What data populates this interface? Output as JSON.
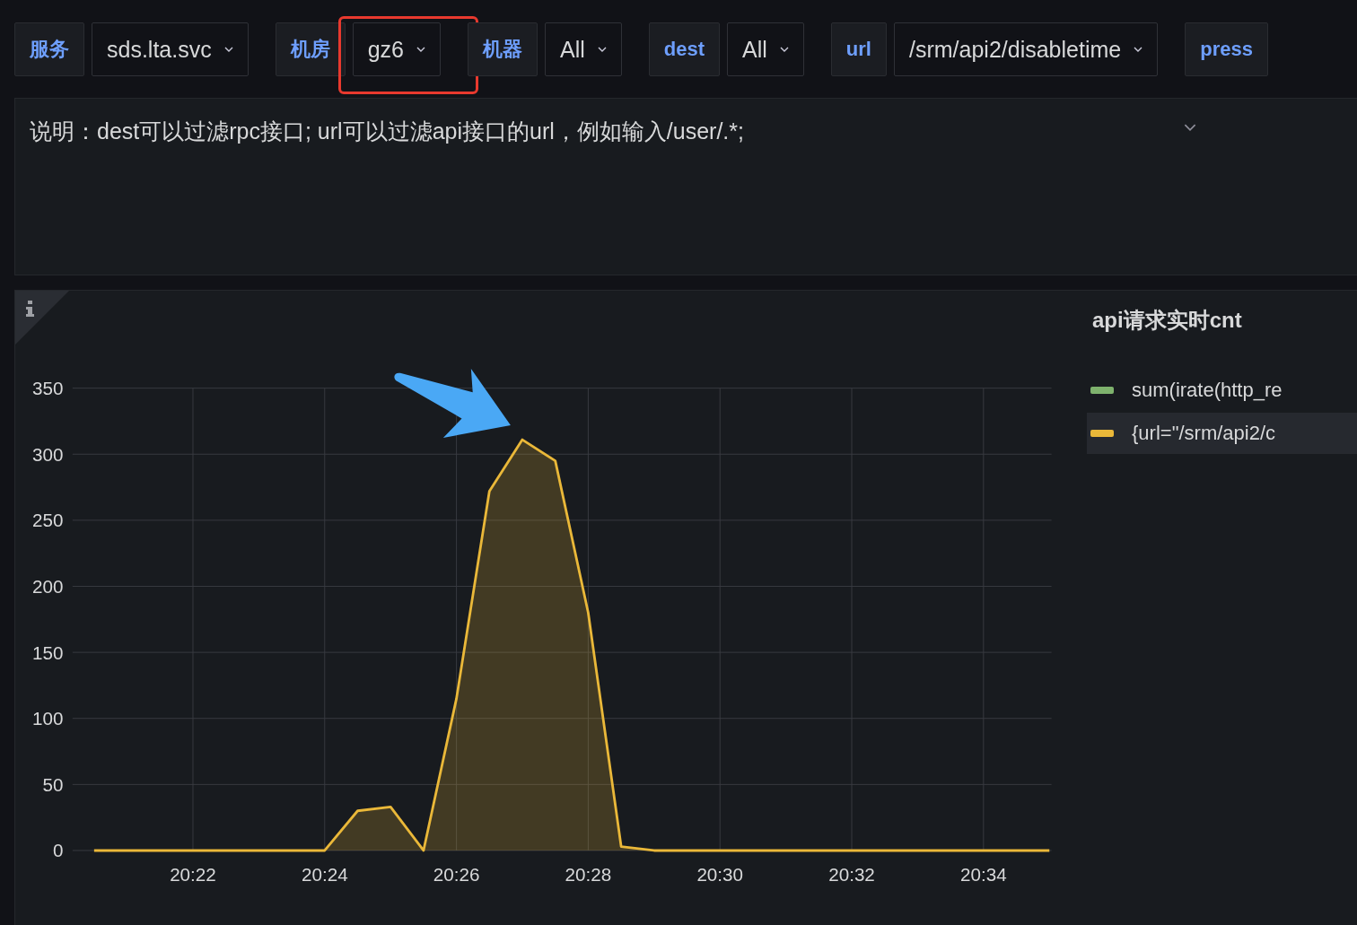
{
  "variables": [
    {
      "label": "服务",
      "value": "sds.lta.svc"
    },
    {
      "label": "机房",
      "value": "gz6"
    },
    {
      "label": "机器",
      "value": "All"
    },
    {
      "label": "dest",
      "value": "All"
    },
    {
      "label": "url",
      "value": "/srm/api2/disabletime"
    },
    {
      "label": "press"
    }
  ],
  "text_panel": {
    "text": "说明：dest可以过滤rpc接口; url可以过滤api接口的url，例如输入/user/.*;"
  },
  "graph_panel": {
    "title": "api请求实时cnt",
    "legend": [
      {
        "selected": false
      },
      {
        "selected": true
      }
    ],
    "chart_data": {
      "type": "area",
      "grid": true,
      "ylim": [
        0,
        350
      ],
      "yticks": [
        0,
        50,
        100,
        150,
        200,
        250,
        300,
        350
      ],
      "categories": [
        null,
        null,
        null,
        "20:22",
        null,
        null,
        null,
        "20:24",
        null,
        null,
        null,
        "20:26",
        null,
        null,
        null,
        "20:28",
        null,
        null,
        null,
        "20:30",
        null,
        null,
        null,
        "20:32",
        null,
        null,
        null,
        "20:34",
        null,
        null
      ],
      "series": [
        {
          "name": "sum(irate(http_re",
          "color": "#7eb26d",
          "values": [
            null,
            null,
            null,
            null,
            null,
            null,
            null,
            null,
            null,
            null,
            null,
            null,
            null,
            null,
            null,
            null,
            null,
            null,
            null,
            null,
            null,
            null,
            null,
            null,
            null,
            null,
            null,
            null,
            null,
            null
          ]
        },
        {
          "name": "{url=\"/srm/api2/c",
          "color": "#eab839",
          "values": [
            0,
            0,
            0,
            0,
            0,
            0,
            0,
            0,
            30,
            33,
            0,
            115,
            272,
            311,
            295,
            180,
            3,
            0,
            0,
            0,
            0,
            0,
            0,
            0,
            0,
            0,
            0,
            0,
            0,
            0
          ]
        }
      ]
    }
  }
}
